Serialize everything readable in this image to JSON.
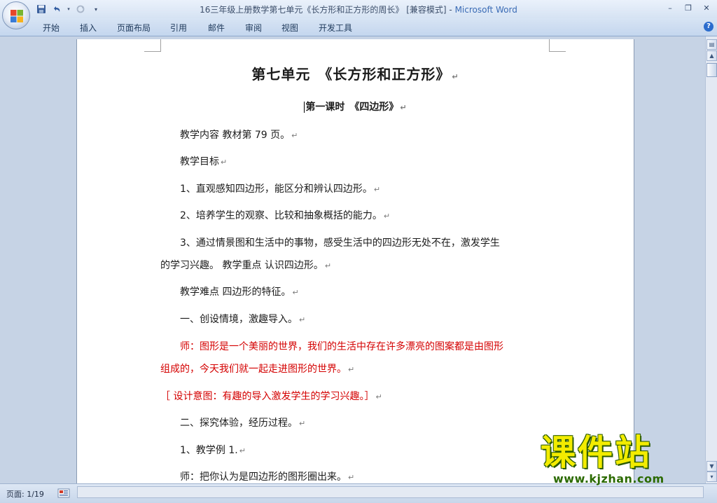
{
  "window": {
    "title_doc": "16三年级上册数学第七单元《长方形和正方形的周长》 [兼容模式] - ",
    "title_app": "Microsoft Word"
  },
  "ribbon": {
    "tabs": [
      "开始",
      "插入",
      "页面布局",
      "引用",
      "邮件",
      "审阅",
      "视图",
      "开发工具"
    ]
  },
  "document": {
    "heading1": "第七单元　《长方形和正方形》",
    "heading2": "第一课时　《四边形》",
    "paragraph_mark": "↵",
    "paragraphs": [
      "教学内容 教材第 79 页。",
      "教学目标",
      "1、直观感知四边形，能区分和辨认四边形。",
      "2、培养学生的观察、比较和抽象概括的能力。",
      "3、通过情景图和生活中的事物，感受生活中的四边形无处不在，激发学生",
      "的学习兴趣。 教学重点 认识四边形。",
      "教学难点 四边形的特征。",
      "一、创设情境，激趣导入。",
      "师：图形是一个美丽的世界，我们的生活中存在许多漂亮的图案都是由图形",
      "组成的，今天我们就一起走进图形的世界。",
      "［ 设计意图：有趣的导入激发学生的学习兴趣。］",
      "二、探究体验，经历过程。",
      "1、教学例 1.",
      "师：把你认为是四边形的图形圈出来。"
    ],
    "highlight_color": "#d40000"
  },
  "statusbar": {
    "page": "页面: 1/19"
  },
  "watermark": {
    "title": "课件站",
    "url": "www.kjzhan.com"
  },
  "icons": {
    "office": "office-logo-icon",
    "save": "save-icon",
    "undo": "undo-icon",
    "redo": "redo-icon",
    "customize": "qat-dropdown-icon",
    "help": "help-icon"
  }
}
